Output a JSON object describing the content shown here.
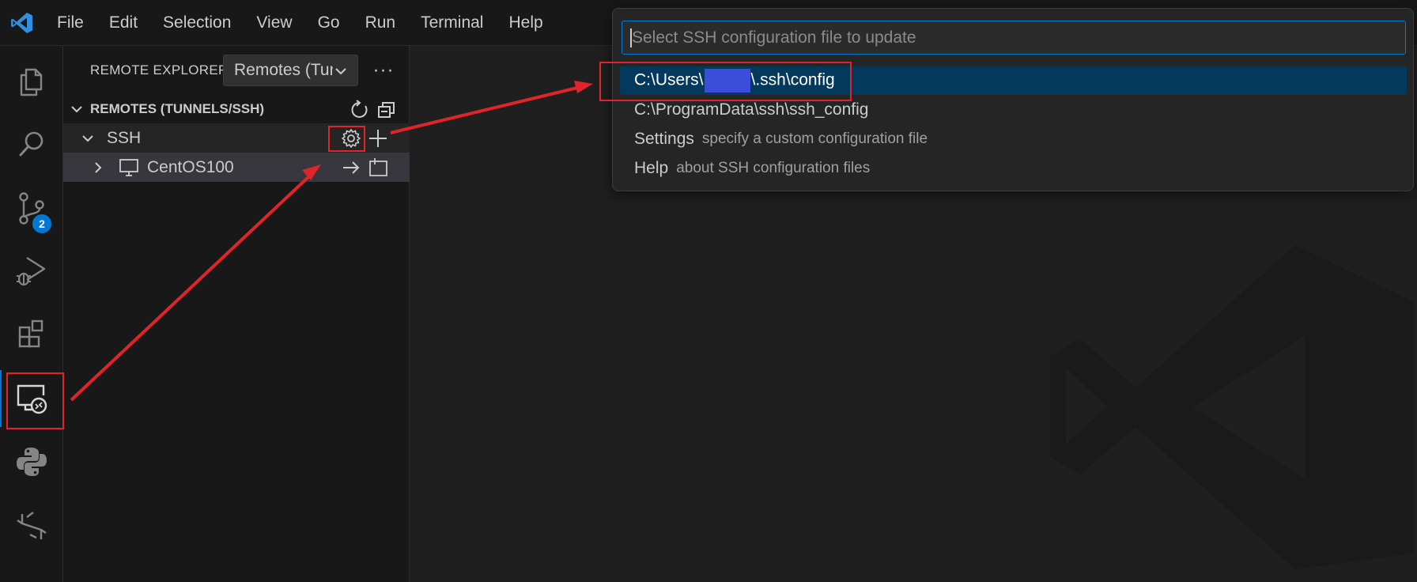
{
  "menu": {
    "items": [
      "File",
      "Edit",
      "Selection",
      "View",
      "Go",
      "Run",
      "Terminal",
      "Help"
    ]
  },
  "activity_bar": {
    "items": [
      {
        "icon": "explorer-icon"
      },
      {
        "icon": "search-icon"
      },
      {
        "icon": "source-control-icon",
        "badge": "2"
      },
      {
        "icon": "run-debug-icon"
      },
      {
        "icon": "extensions-icon"
      },
      {
        "icon": "remote-explorer-icon",
        "active": true
      },
      {
        "icon": "python-icon"
      },
      {
        "icon": "testing-icon"
      }
    ]
  },
  "sidebar": {
    "title": "REMOTE EXPLORER",
    "select_value": "Remotes (Tunnels/SSH)",
    "more_label": "···",
    "section_title": "REMOTES (TUNNELS/SSH)",
    "ssh_group": "SSH",
    "host": "CentOS100"
  },
  "quickpick": {
    "placeholder": "Select SSH configuration file to update",
    "items": [
      {
        "label_prefix": "C:\\Users\\",
        "label_suffix": "\\.ssh\\config",
        "description": ""
      },
      {
        "label": "C:\\ProgramData\\ssh\\ssh_config",
        "description": ""
      },
      {
        "label": "Settings",
        "description": "specify a custom configuration file"
      },
      {
        "label": "Help",
        "description": "about SSH configuration files"
      }
    ]
  },
  "colors": {
    "accent": "#0078d4",
    "annotation": "#e0242b",
    "selection": "#04395e",
    "redaction": "#3d4ddb"
  }
}
